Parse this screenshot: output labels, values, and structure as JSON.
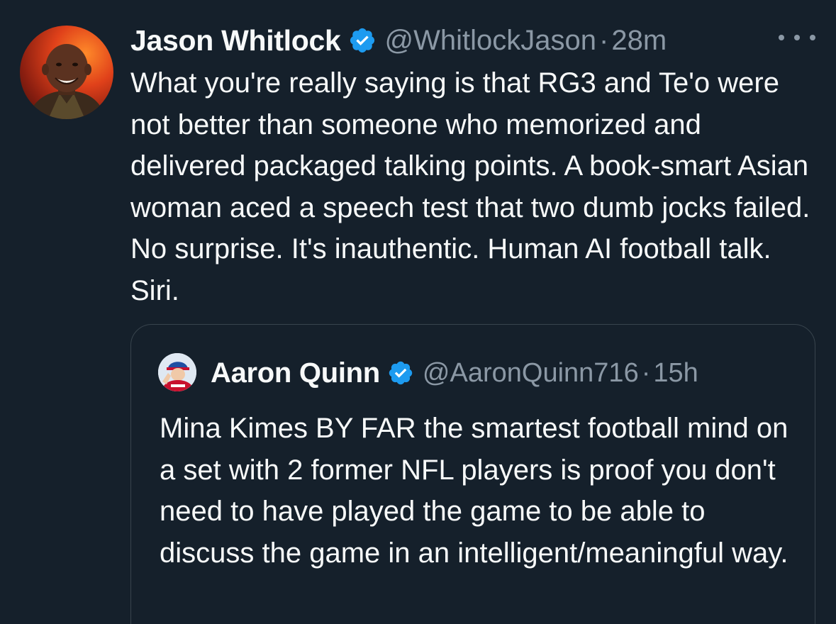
{
  "tweet": {
    "author": {
      "name": "Jason Whitlock",
      "handle": "@WhitlockJason",
      "time": "28m",
      "separator": "·"
    },
    "text": "What you're really saying is that RG3 and Te'o were not better than someone who memorized and delivered packaged talking points. A book-smart Asian woman aced a speech test that two dumb jocks failed. No surprise. It's inauthentic. Human AI football talk. Siri.",
    "more_icon": "more-horizontal-icon"
  },
  "quoted_tweet": {
    "author": {
      "name": "Aaron Quinn",
      "handle": "@AaronQuinn716",
      "time": "15h",
      "separator": "·"
    },
    "text": "Mina Kimes BY FAR the smartest football mind on a set with 2 former NFL players is proof you don't need to have played the game to be able to discuss the game in an intelligent/meaningful way."
  },
  "colors": {
    "background": "#15202b",
    "text_primary": "#f7f9f9",
    "text_secondary": "#8b98a5",
    "verified": "#1d9bf0",
    "border": "#38444d"
  }
}
